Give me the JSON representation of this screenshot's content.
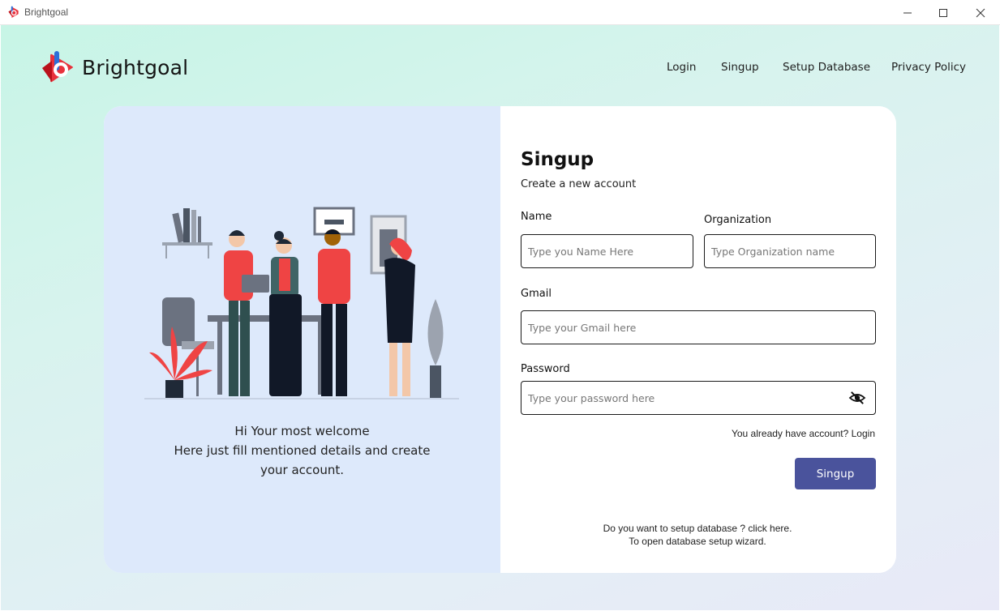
{
  "window": {
    "title": "Brightgoal"
  },
  "header": {
    "brand": "Brightgoal",
    "nav": [
      "Login",
      "Singup",
      "Setup Database",
      "Privacy Policy"
    ]
  },
  "left": {
    "welcome_line1": "Hi Your most welcome",
    "welcome_line2": "Here just fill mentioned details and create",
    "welcome_line3": "your account."
  },
  "form": {
    "title": "Singup",
    "subtitle": "Create a new account",
    "name_label": "Name",
    "name_placeholder": "Type you Name Here",
    "org_label": "Organization",
    "org_placeholder": "Type Organization name",
    "gmail_label": "Gmail",
    "gmail_placeholder": "Type your Gmail here",
    "password_label": "Password",
    "password_placeholder": "Type your password here",
    "already_text": "You already have account? Login",
    "submit_label": "Singup",
    "db_line1": "Do you want to setup database ? click here.",
    "db_line2": "To open database setup wizard."
  },
  "colors": {
    "accent": "#4a539c",
    "brand_red": "#e8323c",
    "panel_blue": "#dde9fb"
  }
}
